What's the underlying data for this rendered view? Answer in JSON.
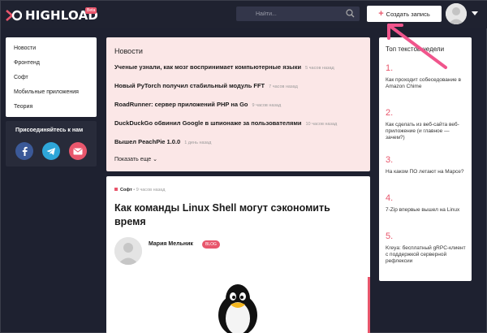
{
  "header": {
    "logo_text": "HIGHLOAD",
    "beta_badge": "Beta",
    "search_placeholder": "Найти...",
    "create_button": "Создать запись"
  },
  "sidebar": {
    "menu": [
      {
        "label": "Новости"
      },
      {
        "label": "Фронтенд"
      },
      {
        "label": "Софт"
      },
      {
        "label": "Мобильные приложения"
      },
      {
        "label": "Теория"
      }
    ],
    "join_title": "Присоединяйтесь к нам",
    "social": [
      {
        "icon": "facebook-icon",
        "color": "#3b5998"
      },
      {
        "icon": "telegram-icon",
        "color": "#2ea6d9"
      },
      {
        "icon": "mail-icon",
        "color": "#e8566c"
      }
    ]
  },
  "news": {
    "title": "Новости",
    "items": [
      {
        "text": "Ученые узнали, как мозг воспринимает компьютерные языки",
        "time": "5 часов назад"
      },
      {
        "text": "Новый PyTorch получил стабильный модуль FFT",
        "time": "7 часов назад"
      },
      {
        "text": "RoadRunner: сервер приложений PHP на Go",
        "time": "9 часов назад"
      },
      {
        "text": "DuckDuckGo обвинил Google в шпионаже за пользователями",
        "time": "10 часов назад"
      },
      {
        "text": "Вышел PeachPie 1.0.0",
        "time": "1 день назад"
      }
    ],
    "show_more": "Показать еще"
  },
  "article": {
    "category": "Софт",
    "time": "• 9 часов назад",
    "title": "Как команды Linux Shell могут сэкономить время",
    "author": "Мария Мельник",
    "tag": "BLOG"
  },
  "top_texts": {
    "title": "Топ текстов недели",
    "items": [
      {
        "num": "1.",
        "text": "Как проходит собеседование в Amazon Chime"
      },
      {
        "num": "2.",
        "text": "Как сделать из веб-сайта веб-приложение (и главное — зачем?)"
      },
      {
        "num": "3.",
        "text": "На каком ПО летают на Марсе?"
      },
      {
        "num": "4.",
        "text": "7-Zip впервые вышел на Linux"
      },
      {
        "num": "5.",
        "text": "Kreya: бесплатный gRPC-клиент с поддержкой серверной рефлексии"
      }
    ]
  },
  "colors": {
    "accent": "#e8566c",
    "header_bg": "#1f2230",
    "news_bg": "#fbe7e7"
  }
}
